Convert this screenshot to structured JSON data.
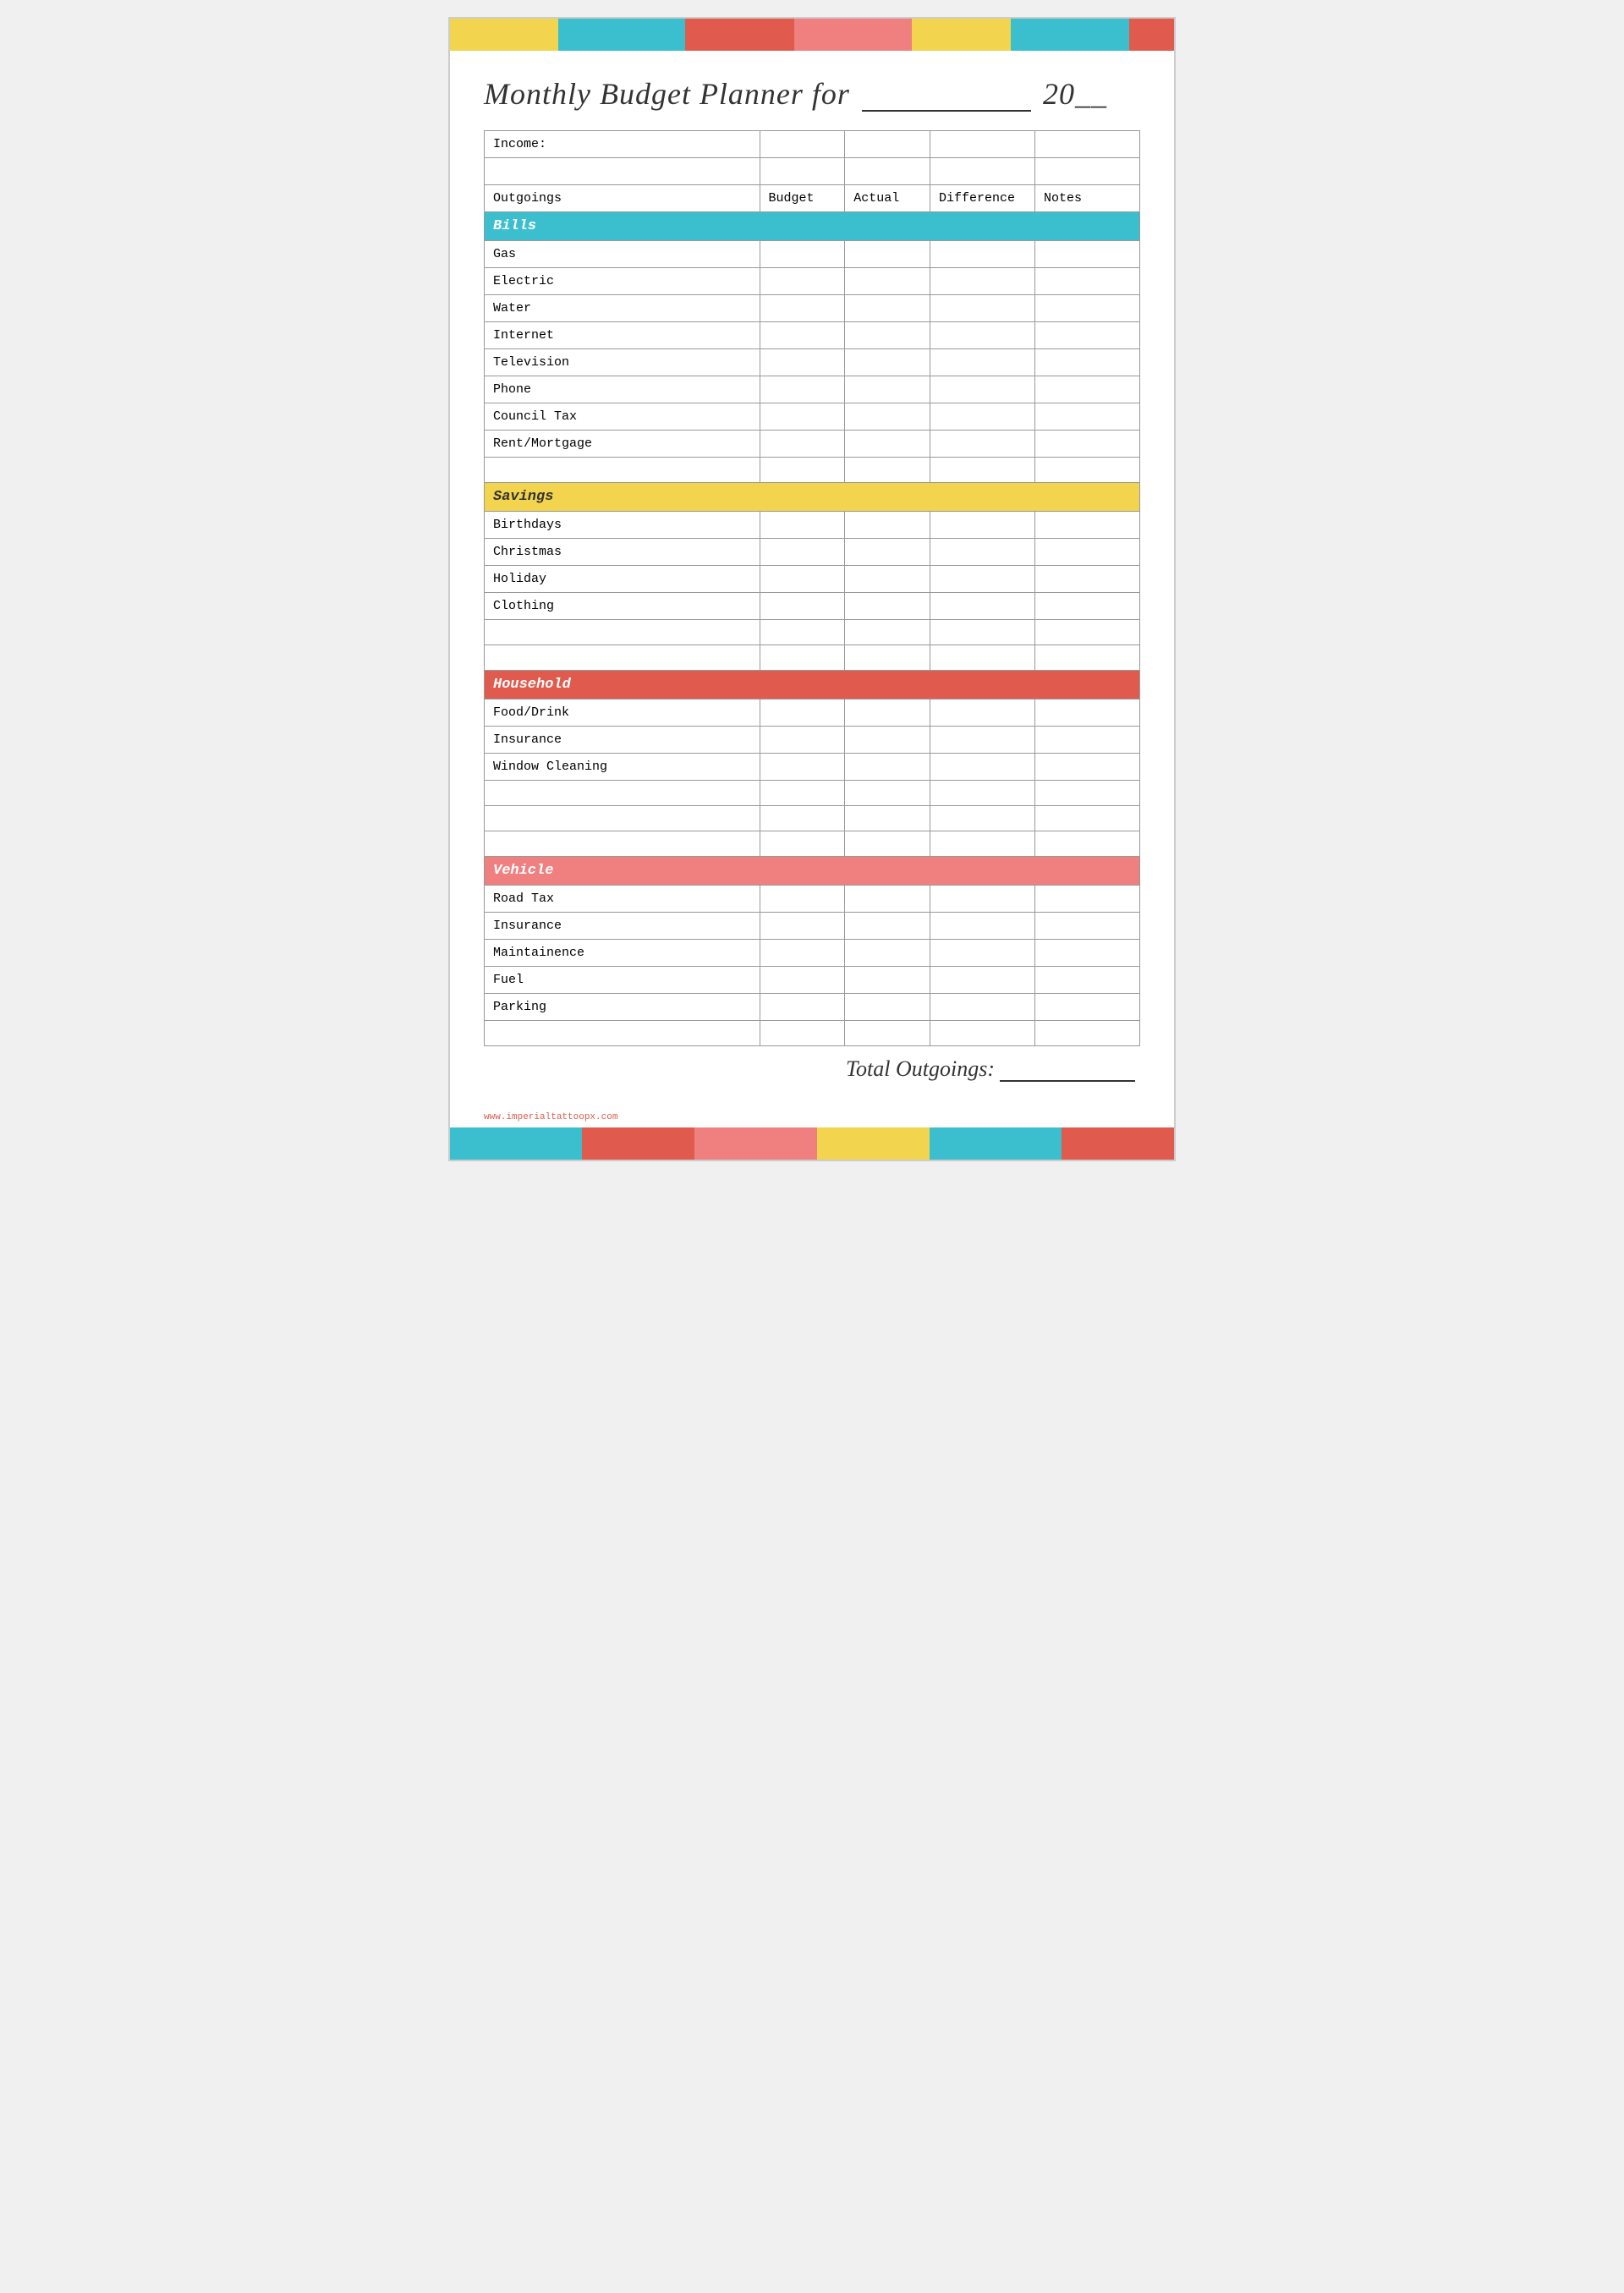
{
  "page": {
    "title": "Monthly Budget Planner for",
    "title_year_prefix": "20",
    "title_year_suffix": "__",
    "watermark": "www.imperialtattoopx.com"
  },
  "color_bars": [
    {
      "class": "cb1"
    },
    {
      "class": "cb2"
    },
    {
      "class": "cb3"
    },
    {
      "class": "cb4"
    },
    {
      "class": "cb5"
    },
    {
      "class": "cb6"
    },
    {
      "class": "cb7"
    }
  ],
  "table": {
    "income_label": "Income:",
    "columns": {
      "outgoings": "Outgoings",
      "budget": "Budget",
      "actual": "Actual",
      "difference": "Difference",
      "notes": "Notes"
    },
    "sections": [
      {
        "label": "Bills",
        "class": "section-bills",
        "items": [
          "Gas",
          "Electric",
          "Water",
          "Internet",
          "Television",
          "Phone",
          "Council Tax",
          "Rent/Mortgage",
          ""
        ]
      },
      {
        "label": "Savings",
        "class": "section-savings",
        "items": [
          "Birthdays",
          "Christmas",
          "Holiday",
          "Clothing",
          "",
          ""
        ]
      },
      {
        "label": "Household",
        "class": "section-household",
        "items": [
          "Food/Drink",
          "Insurance",
          "Window Cleaning",
          "",
          "",
          ""
        ]
      },
      {
        "label": "Vehicle",
        "class": "section-vehicle",
        "items": [
          "Road Tax",
          "Insurance",
          "Maintainence",
          "Fuel",
          "Parking",
          ""
        ]
      }
    ],
    "total_label": "Total Outgoings:",
    "total_line": "_____"
  }
}
